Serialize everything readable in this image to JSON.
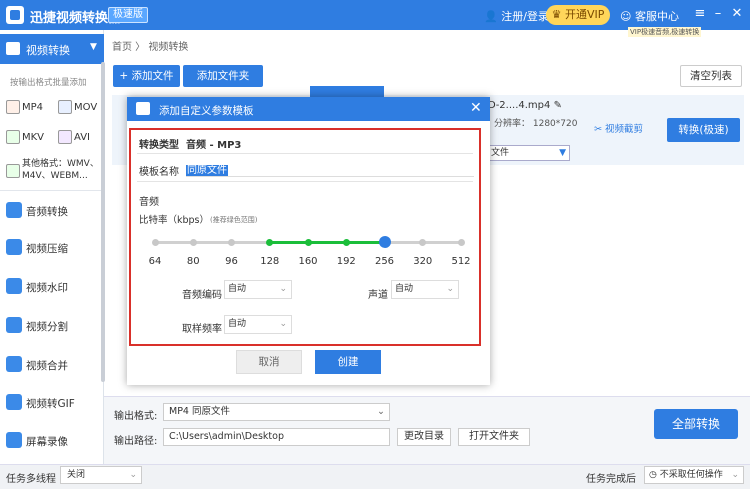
{
  "app": {
    "title": "迅捷视频转换器",
    "edition": "极速版",
    "login": "注册/登录",
    "vip_button": "开通VIP",
    "service": "客服中心",
    "vip_banner": "VIP极速音频,极速转换"
  },
  "sidebar": {
    "active_tab": "视频转换",
    "batch_hint": "按输出格式批量添加",
    "formats": [
      "MP4",
      "MOV",
      "MKV",
      "AVI"
    ],
    "other_formats": [
      "其他格式：WMV、",
      "M4V、WEBM..."
    ],
    "items": [
      {
        "label": "音频转换",
        "icon": "music-icon"
      },
      {
        "label": "视频压缩",
        "icon": "compress-icon"
      },
      {
        "label": "视频水印",
        "icon": "watermark-icon"
      },
      {
        "label": "视频分割",
        "icon": "split-icon"
      },
      {
        "label": "视频合并",
        "icon": "merge-icon"
      },
      {
        "label": "视频转GIF",
        "icon": "gif-icon"
      },
      {
        "label": "屏幕录像",
        "icon": "record-icon"
      }
    ]
  },
  "main": {
    "breadcrumb": "首页 〉 视频转换",
    "add_file": "+ 添加文件",
    "add_folder": "添加文件夹",
    "clear_list": "清空列表",
    "file": {
      "name": "D-2....4.mp4",
      "resolution": "分辨率：  1280*720",
      "format": "文件",
      "edit": "视频截剪",
      "convert": "转换(极速)"
    }
  },
  "output": {
    "format_label": "输出格式:",
    "format_value": "MP4  同原文件",
    "path_label": "输出路径:",
    "path_value": "C:\\Users\\admin\\Desktop",
    "change_dir": "更改目录",
    "open_folder": "打开文件夹",
    "convert_all": "全部转换"
  },
  "status": {
    "multi_label": "任务多线程",
    "multi_value": "关闭",
    "done_label": "任务完成后",
    "done_value": "不采取任何操作"
  },
  "dialog": {
    "title": "添加自定义参数模板",
    "conv_type_label": "转换类型",
    "conv_type_value": "音频 - MP3",
    "template_label": "模板名称",
    "template_value": "同原文件",
    "audio_label": "音频",
    "bitrate_label": "比特率（kbps）",
    "bitrate_hint": "(推荐绿色范围)",
    "bitrate_ticks": [
      "64",
      "80",
      "96",
      "128",
      "160",
      "192",
      "256",
      "320",
      "512"
    ],
    "bitrate_selected": "256",
    "codec_label": "音频编码",
    "codec_value": "自动",
    "channel_label": "声道",
    "channel_value": "自动",
    "samplerate_label": "取样频率",
    "samplerate_value": "自动",
    "cancel": "取消",
    "create": "创建"
  }
}
